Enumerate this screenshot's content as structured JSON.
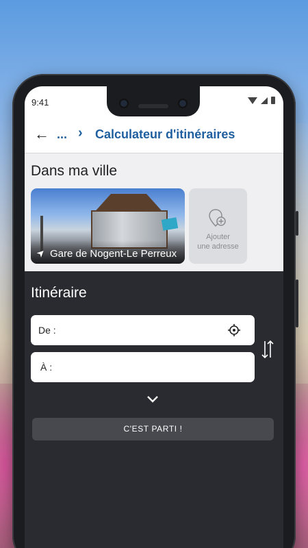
{
  "status_bar": {
    "time": "9:41"
  },
  "header": {
    "breadcrumb_ellipsis": "...",
    "title": "Calculateur d'itinéraires"
  },
  "city": {
    "title": "Dans ma ville",
    "place_card": {
      "name": "Gare de Nogent-Le Perreux"
    },
    "add_card": {
      "line1": "Ajouter",
      "line2": "une adresse"
    }
  },
  "itinerary": {
    "title": "Itinéraire",
    "from_label": "De :",
    "to_label": "À  :",
    "go_button": "C'EST PARTI !"
  },
  "colors": {
    "accent": "#1f5f9f",
    "dark_panel": "#2a2b30",
    "light_panel": "#f0f0f2"
  }
}
